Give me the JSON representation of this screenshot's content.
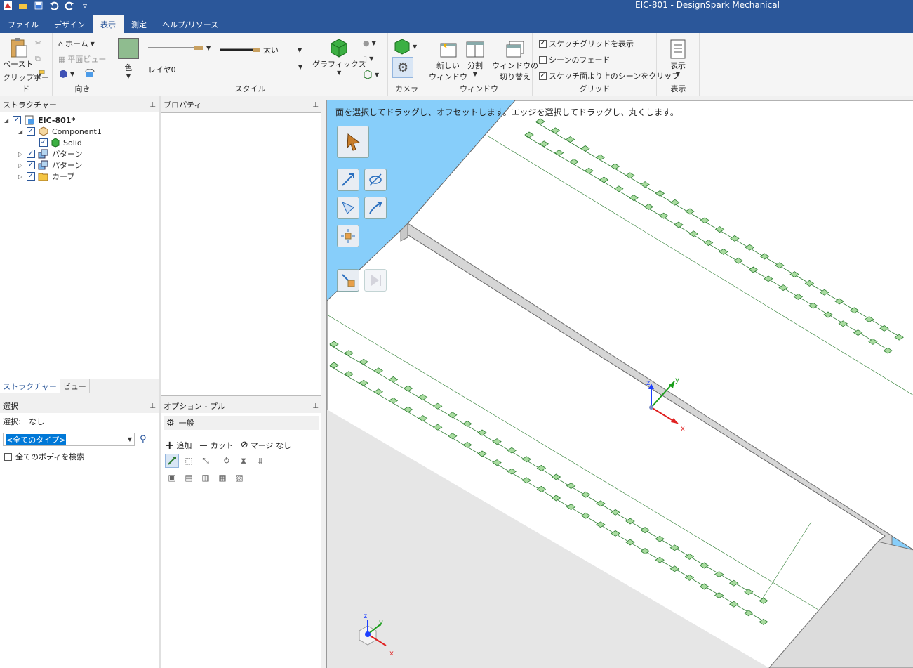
{
  "app": {
    "title": "EIC-801 - DesignSpark Mechanical"
  },
  "ribbon_tabs": [
    {
      "label": "ファイル",
      "active": false
    },
    {
      "label": "デザイン",
      "active": false
    },
    {
      "label": "表示",
      "active": true
    },
    {
      "label": "測定",
      "active": false
    },
    {
      "label": "ヘルプ/リソース",
      "active": false
    }
  ],
  "clipboard": {
    "paste_label": "ペースト",
    "group_label": "クリップボード"
  },
  "orient": {
    "home_label": "ホーム",
    "plan_view_label": "平面ビュー",
    "group_label": "向き"
  },
  "style": {
    "color_label": "色",
    "layer_label": "レイヤ0",
    "thick_label": "太い",
    "graphics_label": "グラフィックス",
    "group_label": "スタイル"
  },
  "camera": {
    "group_label": "カメラ"
  },
  "window": {
    "new_window_label": "新しい\nウィンドウ",
    "split_label": "分割",
    "switch_label": "ウィンドウの\n切り替え",
    "group_label": "ウィンドウ"
  },
  "grid": {
    "show_sketch_grid": {
      "label": "スケッチグリッドを表示",
      "checked": true
    },
    "scene_fade": {
      "label": "シーンのフェード",
      "checked": false
    },
    "clip_scene": {
      "label": "スケッチ面より上のシーンをクリップ",
      "checked": true
    },
    "group_label": "グリッド"
  },
  "display": {
    "button_label": "表示",
    "group_label": "表示"
  },
  "structure_panel": {
    "title": "ストラクチャー",
    "tree": [
      {
        "label": "EIC-801*",
        "level": 0,
        "expanded": true,
        "bold": true,
        "icon": "document-icon"
      },
      {
        "label": "Component1",
        "level": 1,
        "expanded": true,
        "icon": "component-icon"
      },
      {
        "label": "Solid",
        "level": 2,
        "icon": "solid-icon"
      },
      {
        "label": "パターン",
        "level": 1,
        "expanded": false,
        "icon": "pattern-icon"
      },
      {
        "label": "パターン",
        "level": 1,
        "expanded": false,
        "icon": "pattern-icon"
      },
      {
        "label": "カーブ",
        "level": 1,
        "expanded": false,
        "icon": "curve-folder-icon"
      }
    ],
    "tabs": [
      "ストラクチャー",
      "ビュー"
    ]
  },
  "properties_panel": {
    "title": "プロパティ"
  },
  "selection_panel": {
    "title": "選択",
    "selection_label": "選択:",
    "selection_value": "なし",
    "type_filter": "<全てのタイプ>",
    "search_all_label": "全てのボディを検索"
  },
  "options_panel": {
    "title": "オプション - プル",
    "general_label": "一般",
    "add_label": "追加",
    "cut_label": "カット",
    "no_merge_label": "マージ なし"
  },
  "viewport": {
    "hint": "面を選択してドラッグし、オフセットします。エッジを選択してドラッグし、丸くします。",
    "axis_labels": {
      "x": "x",
      "y": "y",
      "z": "z"
    }
  },
  "colors": {
    "accent": "#2b579a",
    "viewport_bg": "#87cefa",
    "pad_green": "#a9dca0",
    "pad_stroke": "#2e7d32"
  }
}
